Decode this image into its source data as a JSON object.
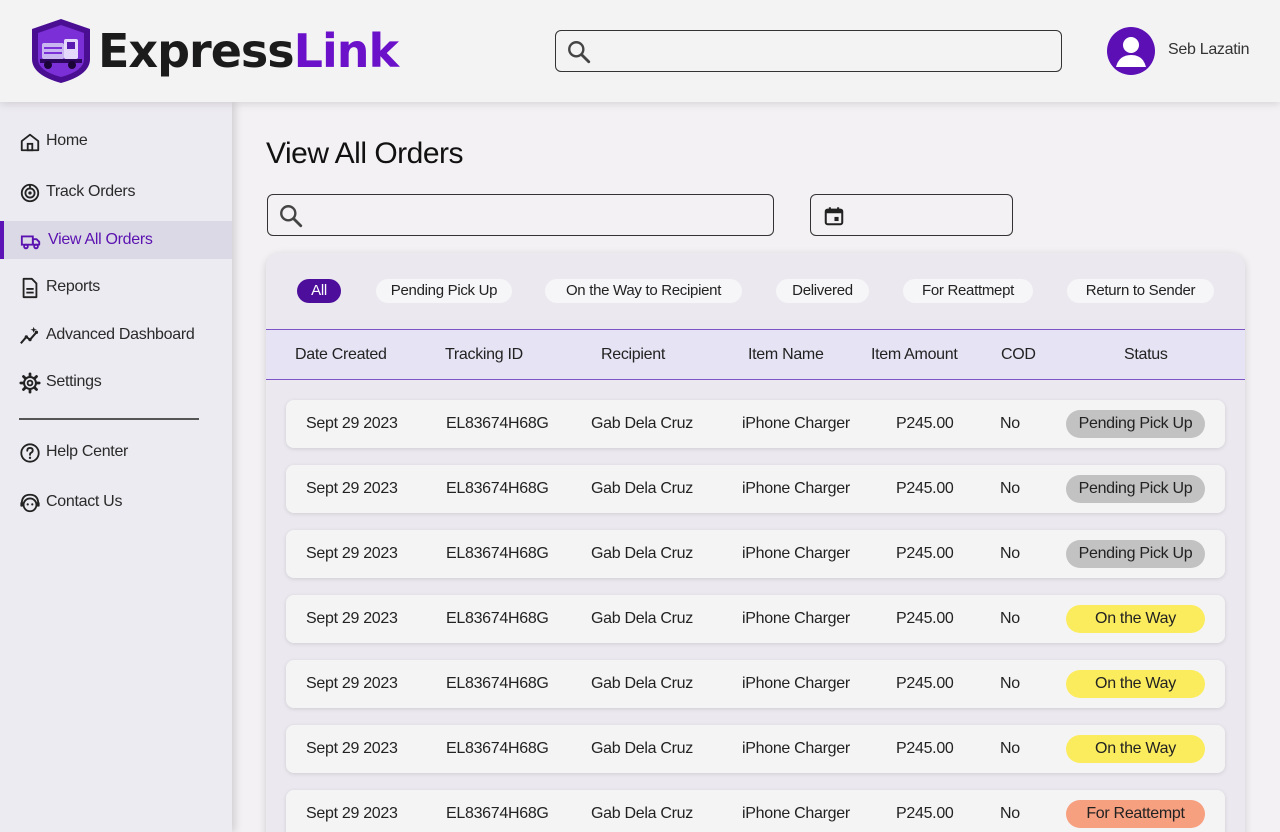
{
  "header": {
    "brand_part1": "Express",
    "brand_part2": "Link",
    "search_placeholder": "",
    "user_name": "Seb Lazatin"
  },
  "sidebar": {
    "items": [
      {
        "label": "Home",
        "icon": "home-icon"
      },
      {
        "label": "Track Orders",
        "icon": "track-icon"
      },
      {
        "label": "View All Orders",
        "icon": "truck-icon",
        "active": true
      },
      {
        "label": "Reports",
        "icon": "document-icon"
      },
      {
        "label": "Advanced Dashboard",
        "icon": "analytics-icon"
      },
      {
        "label": "Settings",
        "icon": "gear-icon"
      }
    ],
    "secondary": [
      {
        "label": "Help Center",
        "icon": "help-icon"
      },
      {
        "label": "Contact Us",
        "icon": "support-agent-icon"
      }
    ]
  },
  "main": {
    "title": "View All Orders",
    "search_placeholder": "",
    "date_placeholder": "",
    "filters": [
      "All",
      "Pending Pick Up",
      "On the Way to Recipient",
      "Delivered",
      "For Reattmept",
      "Return to Sender"
    ],
    "columns": [
      "Date Created",
      "Tracking ID",
      "Recipient",
      "Item Name",
      "Item Amount",
      "COD",
      "Status"
    ],
    "rows": [
      {
        "date": "Sept 29 2023",
        "tracking": "EL83674H68G",
        "recipient": "Gab Dela Cruz",
        "item": "iPhone Charger",
        "amount": "P245.00",
        "cod": "No",
        "status": "Pending Pick Up"
      },
      {
        "date": "Sept 29 2023",
        "tracking": "EL83674H68G",
        "recipient": "Gab Dela Cruz",
        "item": "iPhone Charger",
        "amount": "P245.00",
        "cod": "No",
        "status": "Pending Pick Up"
      },
      {
        "date": "Sept 29 2023",
        "tracking": "EL83674H68G",
        "recipient": "Gab Dela Cruz",
        "item": "iPhone Charger",
        "amount": "P245.00",
        "cod": "No",
        "status": "Pending Pick Up"
      },
      {
        "date": "Sept 29 2023",
        "tracking": "EL83674H68G",
        "recipient": "Gab Dela Cruz",
        "item": "iPhone Charger",
        "amount": "P245.00",
        "cod": "No",
        "status": "On the Way"
      },
      {
        "date": "Sept 29 2023",
        "tracking": "EL83674H68G",
        "recipient": "Gab Dela Cruz",
        "item": "iPhone Charger",
        "amount": "P245.00",
        "cod": "No",
        "status": "On the Way"
      },
      {
        "date": "Sept 29 2023",
        "tracking": "EL83674H68G",
        "recipient": "Gab Dela Cruz",
        "item": "iPhone Charger",
        "amount": "P245.00",
        "cod": "No",
        "status": "On the Way"
      },
      {
        "date": "Sept 29 2023",
        "tracking": "EL83674H68G",
        "recipient": "Gab Dela Cruz",
        "item": "iPhone Charger",
        "amount": "P245.00",
        "cod": "No",
        "status": "For Reattempt"
      }
    ]
  },
  "colors": {
    "brand": "#6a11c9",
    "active_nav": "#5a12b0",
    "chip_active": "#4d0e9c",
    "status_pending": "#c2c2c2",
    "status_on_the_way": "#fbec5e",
    "status_reattempt": "#f6a080"
  }
}
